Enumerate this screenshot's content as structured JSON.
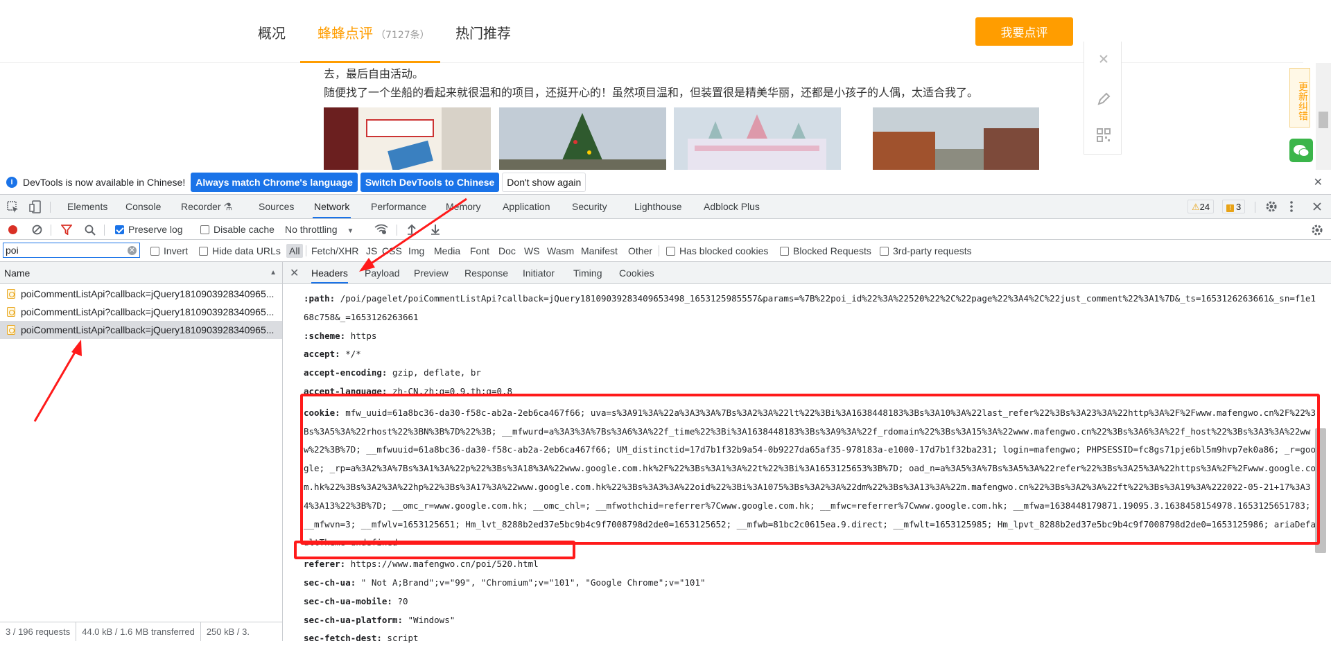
{
  "page": {
    "tabs": [
      {
        "label": "概况"
      },
      {
        "label": "蜂蜂点评",
        "count": "（7127条）"
      },
      {
        "label": "热门推荐"
      }
    ],
    "review_button": "我要点评",
    "text_line1": "去，最后自由活动。",
    "text_line2": "随便找了一个坐船的看起来就很温和的项目，还挺开心的！虽然项目温和，但装置很是精美华丽，还都是小孩子的人偶，太适合我了。",
    "correction_tab": "更新纠错"
  },
  "infobar": {
    "message": "DevTools is now available in Chinese!",
    "btn_match": "Always match Chrome's language",
    "btn_switch": "Switch DevTools to Chinese",
    "btn_dismiss": "Don't show again"
  },
  "devtools_tabs": [
    "Elements",
    "Console",
    "Recorder",
    "Sources",
    "Network",
    "Performance",
    "Memory",
    "Application",
    "Security",
    "Lighthouse",
    "Adblock Plus"
  ],
  "badges": {
    "warnings": "24",
    "issues": "3"
  },
  "toolbar": {
    "preserve_log": "Preserve log",
    "disable_cache": "Disable cache",
    "throttling": "No throttling"
  },
  "filter": {
    "value": "poi",
    "invert": "Invert",
    "hide_data_urls": "Hide data URLs",
    "types": [
      "All",
      "Fetch/XHR",
      "JS",
      "CSS",
      "Img",
      "Media",
      "Font",
      "Doc",
      "WS",
      "Wasm",
      "Manifest",
      "Other"
    ],
    "blocked_cookies": "Has blocked cookies",
    "blocked_requests": "Blocked Requests",
    "third_party": "3rd-party requests"
  },
  "requests": {
    "header": "Name",
    "rows": [
      "poiCommentListApi?callback=jQuery1810903928340965...",
      "poiCommentListApi?callback=jQuery1810903928340965...",
      "poiCommentListApi?callback=jQuery1810903928340965..."
    ],
    "status": [
      "3 / 196 requests",
      "44.0 kB / 1.6 MB transferred",
      "250 kB / 3."
    ]
  },
  "detail_tabs": [
    "Headers",
    "Payload",
    "Preview",
    "Response",
    "Initiator",
    "Timing",
    "Cookies"
  ],
  "headers": [
    {
      "name": ":path:",
      "value": "/poi/pagelet/poiCommentListApi?callback=jQuery18109039283409653498_1653125985557&params=%7B%22poi_id%22%3A%22520%22%2C%22page%22%3A4%2C%22just_comment%22%3A1%7D&_ts=1653126263661&_sn=f1e168c758&_=1653126263661"
    },
    {
      "name": ":scheme:",
      "value": "https"
    },
    {
      "name": "accept:",
      "value": "*/*"
    },
    {
      "name": "accept-encoding:",
      "value": "gzip, deflate, br"
    },
    {
      "name": "accept-language:",
      "value": "zh-CN,zh;q=0.9,th;q=0.8"
    },
    {
      "name": "cookie:",
      "value": "mfw_uuid=61a8bc36-da30-f58c-ab2a-2eb6ca467f66; uva=s%3A91%3A%22a%3A3%3A%7Bs%3A2%3A%22lt%22%3Bi%3A1638448183%3Bs%3A10%3A%22last_refer%22%3Bs%3A23%3A%22http%3A%2F%2Fwww.mafengwo.cn%2F%22%3Bs%3A5%3A%22rhost%22%3BN%3B%7D%22%3B; __mfwurd=a%3A3%3A%7Bs%3A6%3A%22f_time%22%3Bi%3A1638448183%3Bs%3A9%3A%22f_rdomain%22%3Bs%3A15%3A%22www.mafengwo.cn%22%3Bs%3A6%3A%22f_host%22%3Bs%3A3%3A%22www%22%3B%7D; __mfwuuid=61a8bc36-da30-f58c-ab2a-2eb6ca467f66; UM_distinctid=17d7b1f32b9a54-0b9227da65af35-978183a-e1000-17d7b1f32ba231; login=mafengwo; PHPSESSID=fc8gs71pje6bl5m9hvp7ek0a86; _r=google; _rp=a%3A2%3A%7Bs%3A1%3A%22p%22%3Bs%3A18%3A%22www.google.com.hk%2F%22%3Bs%3A1%3A%22t%22%3Bi%3A1653125653%3B%7D; oad_n=a%3A5%3A%7Bs%3A5%3A%22refer%22%3Bs%3A25%3A%22https%3A%2F%2Fwww.google.com.hk%22%3Bs%3A2%3A%22hp%22%3Bs%3A17%3A%22www.google.com.hk%22%3Bs%3A3%3A%22oid%22%3Bi%3A1075%3Bs%3A2%3A%22dm%22%3Bs%3A13%3A%22m.mafengwo.cn%22%3Bs%3A2%3A%22ft%22%3Bs%3A19%3A%222022-05-21+17%3A34%3A13%22%3B%7D; __omc_r=www.google.com.hk; __omc_chl=; __mfwothchid=referrer%7Cwww.google.com.hk; __mfwc=referrer%7Cwww.google.com.hk; __mfwa=1638448179871.19095.3.1638458154978.1653125651783; __mfwvn=3; __mfwlv=1653125651; Hm_lvt_8288b2ed37e5bc9b4c9f7008798d2de0=1653125652; __mfwb=81bc2c0615ea.9.direct; __mfwlt=1653125985; Hm_lpvt_8288b2ed37e5bc9b4c9f7008798d2de0=1653125986; ariaDefaultTheme=undefined"
    },
    {
      "name": "referer:",
      "value": "https://www.mafengwo.cn/poi/520.html"
    },
    {
      "name": "sec-ch-ua:",
      "value": "\" Not A;Brand\";v=\"99\", \"Chromium\";v=\"101\", \"Google Chrome\";v=\"101\""
    },
    {
      "name": "sec-ch-ua-mobile:",
      "value": "?0"
    },
    {
      "name": "sec-ch-ua-platform:",
      "value": "\"Windows\""
    },
    {
      "name": "sec-fetch-dest:",
      "value": "script"
    }
  ],
  "colors": {
    "accent": "#ff9d00",
    "devtools_blue": "#1a73e8",
    "annotation_red": "#ff1a1a"
  }
}
